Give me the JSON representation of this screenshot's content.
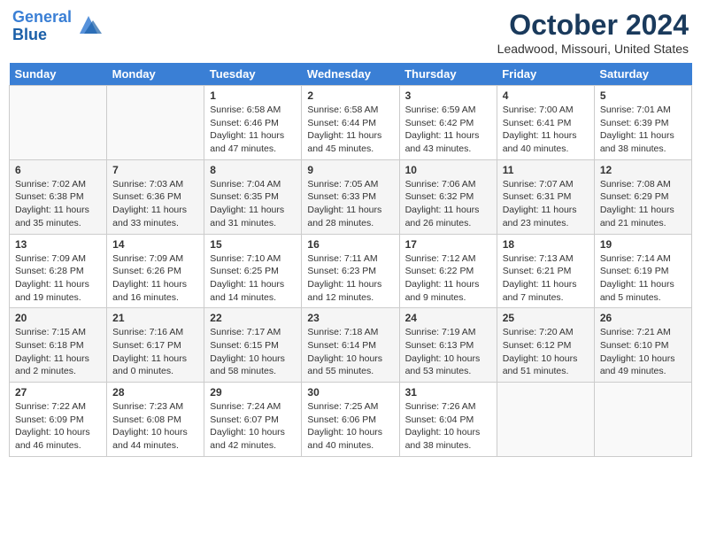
{
  "logo": {
    "line1": "General",
    "line2": "Blue"
  },
  "title": "October 2024",
  "subtitle": "Leadwood, Missouri, United States",
  "days_of_week": [
    "Sunday",
    "Monday",
    "Tuesday",
    "Wednesday",
    "Thursday",
    "Friday",
    "Saturday"
  ],
  "weeks": [
    [
      {
        "day": "",
        "info": ""
      },
      {
        "day": "",
        "info": ""
      },
      {
        "day": "1",
        "info": "Sunrise: 6:58 AM\nSunset: 6:46 PM\nDaylight: 11 hours and 47 minutes."
      },
      {
        "day": "2",
        "info": "Sunrise: 6:58 AM\nSunset: 6:44 PM\nDaylight: 11 hours and 45 minutes."
      },
      {
        "day": "3",
        "info": "Sunrise: 6:59 AM\nSunset: 6:42 PM\nDaylight: 11 hours and 43 minutes."
      },
      {
        "day": "4",
        "info": "Sunrise: 7:00 AM\nSunset: 6:41 PM\nDaylight: 11 hours and 40 minutes."
      },
      {
        "day": "5",
        "info": "Sunrise: 7:01 AM\nSunset: 6:39 PM\nDaylight: 11 hours and 38 minutes."
      }
    ],
    [
      {
        "day": "6",
        "info": "Sunrise: 7:02 AM\nSunset: 6:38 PM\nDaylight: 11 hours and 35 minutes."
      },
      {
        "day": "7",
        "info": "Sunrise: 7:03 AM\nSunset: 6:36 PM\nDaylight: 11 hours and 33 minutes."
      },
      {
        "day": "8",
        "info": "Sunrise: 7:04 AM\nSunset: 6:35 PM\nDaylight: 11 hours and 31 minutes."
      },
      {
        "day": "9",
        "info": "Sunrise: 7:05 AM\nSunset: 6:33 PM\nDaylight: 11 hours and 28 minutes."
      },
      {
        "day": "10",
        "info": "Sunrise: 7:06 AM\nSunset: 6:32 PM\nDaylight: 11 hours and 26 minutes."
      },
      {
        "day": "11",
        "info": "Sunrise: 7:07 AM\nSunset: 6:31 PM\nDaylight: 11 hours and 23 minutes."
      },
      {
        "day": "12",
        "info": "Sunrise: 7:08 AM\nSunset: 6:29 PM\nDaylight: 11 hours and 21 minutes."
      }
    ],
    [
      {
        "day": "13",
        "info": "Sunrise: 7:09 AM\nSunset: 6:28 PM\nDaylight: 11 hours and 19 minutes."
      },
      {
        "day": "14",
        "info": "Sunrise: 7:09 AM\nSunset: 6:26 PM\nDaylight: 11 hours and 16 minutes."
      },
      {
        "day": "15",
        "info": "Sunrise: 7:10 AM\nSunset: 6:25 PM\nDaylight: 11 hours and 14 minutes."
      },
      {
        "day": "16",
        "info": "Sunrise: 7:11 AM\nSunset: 6:23 PM\nDaylight: 11 hours and 12 minutes."
      },
      {
        "day": "17",
        "info": "Sunrise: 7:12 AM\nSunset: 6:22 PM\nDaylight: 11 hours and 9 minutes."
      },
      {
        "day": "18",
        "info": "Sunrise: 7:13 AM\nSunset: 6:21 PM\nDaylight: 11 hours and 7 minutes."
      },
      {
        "day": "19",
        "info": "Sunrise: 7:14 AM\nSunset: 6:19 PM\nDaylight: 11 hours and 5 minutes."
      }
    ],
    [
      {
        "day": "20",
        "info": "Sunrise: 7:15 AM\nSunset: 6:18 PM\nDaylight: 11 hours and 2 minutes."
      },
      {
        "day": "21",
        "info": "Sunrise: 7:16 AM\nSunset: 6:17 PM\nDaylight: 11 hours and 0 minutes."
      },
      {
        "day": "22",
        "info": "Sunrise: 7:17 AM\nSunset: 6:15 PM\nDaylight: 10 hours and 58 minutes."
      },
      {
        "day": "23",
        "info": "Sunrise: 7:18 AM\nSunset: 6:14 PM\nDaylight: 10 hours and 55 minutes."
      },
      {
        "day": "24",
        "info": "Sunrise: 7:19 AM\nSunset: 6:13 PM\nDaylight: 10 hours and 53 minutes."
      },
      {
        "day": "25",
        "info": "Sunrise: 7:20 AM\nSunset: 6:12 PM\nDaylight: 10 hours and 51 minutes."
      },
      {
        "day": "26",
        "info": "Sunrise: 7:21 AM\nSunset: 6:10 PM\nDaylight: 10 hours and 49 minutes."
      }
    ],
    [
      {
        "day": "27",
        "info": "Sunrise: 7:22 AM\nSunset: 6:09 PM\nDaylight: 10 hours and 46 minutes."
      },
      {
        "day": "28",
        "info": "Sunrise: 7:23 AM\nSunset: 6:08 PM\nDaylight: 10 hours and 44 minutes."
      },
      {
        "day": "29",
        "info": "Sunrise: 7:24 AM\nSunset: 6:07 PM\nDaylight: 10 hours and 42 minutes."
      },
      {
        "day": "30",
        "info": "Sunrise: 7:25 AM\nSunset: 6:06 PM\nDaylight: 10 hours and 40 minutes."
      },
      {
        "day": "31",
        "info": "Sunrise: 7:26 AM\nSunset: 6:04 PM\nDaylight: 10 hours and 38 minutes."
      },
      {
        "day": "",
        "info": ""
      },
      {
        "day": "",
        "info": ""
      }
    ]
  ]
}
